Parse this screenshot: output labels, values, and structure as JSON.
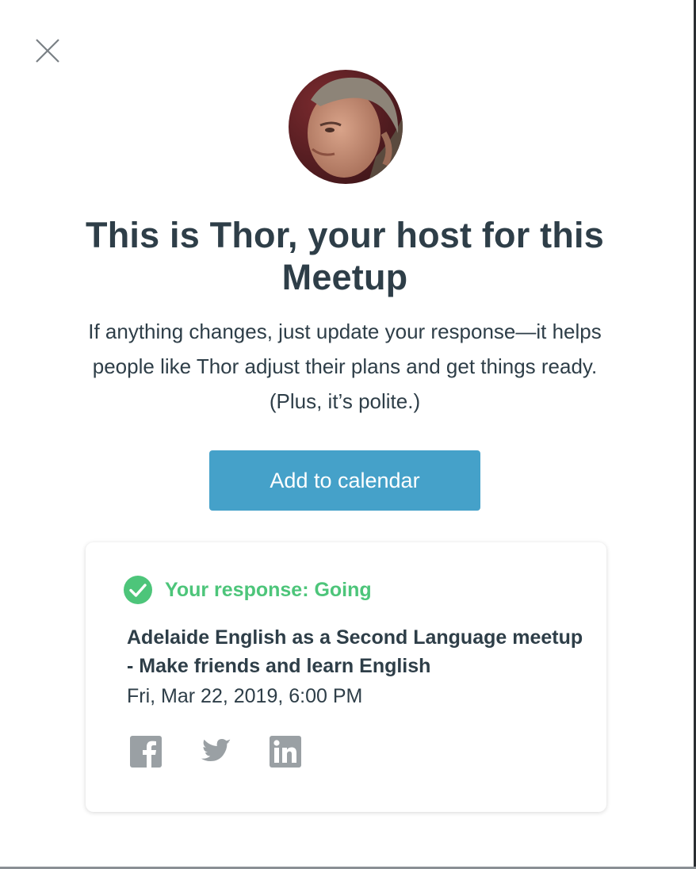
{
  "modal": {
    "close_icon": "close-icon",
    "avatar_alt": "Thor",
    "title": "This is Thor, your host for this Meetup",
    "subtitle": "If anything changes, just update your response—it helps people like Thor adjust their plans and get things ready. (Plus, it’s polite.)",
    "calendar_button": "Add to calendar"
  },
  "card": {
    "status_icon": "check-circle-icon",
    "response": "Your response: Going",
    "event_name": "Adelaide English as a Second Language meetup - Make friends and learn English",
    "event_date": "Fri, Mar 22, 2019, 6:00 PM",
    "share_icons": [
      "facebook-icon",
      "twitter-icon",
      "linkedin-icon"
    ]
  },
  "colors": {
    "text": "#2e3e48",
    "button": "#45a1c9",
    "going": "#4dc57a",
    "social": "#9aa0a4"
  }
}
